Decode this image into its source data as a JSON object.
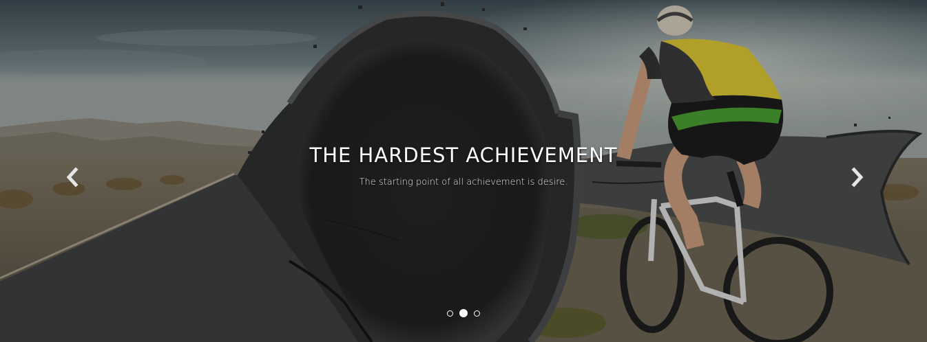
{
  "slide": {
    "title": "THE HARDEST ACHIEVEMENT",
    "subtitle": "The starting point of all achievement is desire."
  },
  "controls": {
    "prev_icon": "chevron-left-icon",
    "next_icon": "chevron-right-icon"
  },
  "indicators": {
    "count": 3,
    "active_index": 1
  },
  "colors": {
    "sky": "#4d5e66",
    "road": "#3a3b3c",
    "jersey_yellow": "#d7c232",
    "shorts_green": "#4a9c32"
  }
}
